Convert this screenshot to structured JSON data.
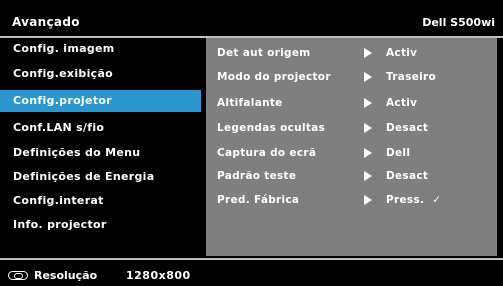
{
  "header": {
    "title": "Avançado",
    "model": "Dell  S500wi"
  },
  "sidebar": {
    "items": [
      {
        "label": "Config. imagem"
      },
      {
        "label": "Config.exibição"
      },
      {
        "label": "Config.projetor"
      },
      {
        "label": "Conf.LAN s/fio"
      },
      {
        "label": "Definições do Menu"
      },
      {
        "label": "Definições de Energia"
      },
      {
        "label": "Config.interat"
      },
      {
        "label": "Info. projector"
      }
    ],
    "active_index": 2,
    "active_color": "#2c97cf"
  },
  "settings": [
    {
      "label": "Det aut origem",
      "value": "Activ"
    },
    {
      "label": "Modo do projector",
      "value": "Traseiro"
    },
    {
      "label": "Altifalante",
      "value": "Activ"
    },
    {
      "label": "Legendas ocultas",
      "value": "Desact"
    },
    {
      "label": "Captura do ecrã",
      "value": "Dell"
    },
    {
      "label": "Padrão teste",
      "value": "Desact"
    },
    {
      "label": "Pred. Fábrica",
      "value": "Press.",
      "check": "✓"
    }
  ],
  "panel_color": "#7f7f7f",
  "footer": {
    "icon": "remote-control-icon",
    "label": "Resolução",
    "value": "1280x800"
  }
}
